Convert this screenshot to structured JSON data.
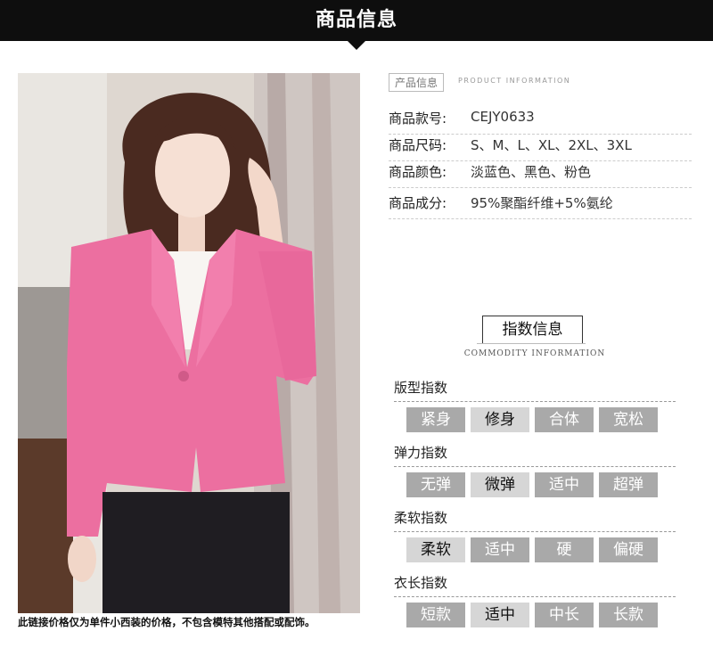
{
  "header": {
    "title": "商品信息"
  },
  "product_info": {
    "tag": "产品信息",
    "tag_en": "PRODUCT INFORMATION",
    "rows": [
      {
        "label": "商品款号:",
        "value": "CEJY0633"
      },
      {
        "label": "商品尺码:",
        "value": "S、M、L、XL、2XL、3XL"
      },
      {
        "label": "商品颜色:",
        "value": "淡蓝色、黑色、粉色"
      },
      {
        "label": "商品成分:",
        "value": "95%聚酯纤维+5%氨纶"
      }
    ]
  },
  "index_info": {
    "title": "指数信息",
    "title_en": "COMMODITY INFORMATION",
    "categories": [
      {
        "title": "版型指数",
        "options": [
          "紧身",
          "修身",
          "合体",
          "宽松"
        ],
        "selected": 1
      },
      {
        "title": "弹力指数",
        "options": [
          "无弹",
          "微弹",
          "适中",
          "超弹"
        ],
        "selected": 1
      },
      {
        "title": "柔软指数",
        "options": [
          "柔软",
          "适中",
          "硬",
          "偏硬"
        ],
        "selected": 0
      },
      {
        "title": "衣长指数",
        "options": [
          "短款",
          "适中",
          "中长",
          "长款"
        ],
        "selected": 1
      }
    ]
  },
  "photo": {
    "caption": "此链接价格仅为单件小西装的价格，不包含模特其他搭配或配饰。"
  },
  "colors": {
    "banner": "#0e0e0e",
    "jacket": "#ec6fa0",
    "option_bg": "#a9a9a9",
    "option_selected_bg": "#d6d6d6"
  }
}
